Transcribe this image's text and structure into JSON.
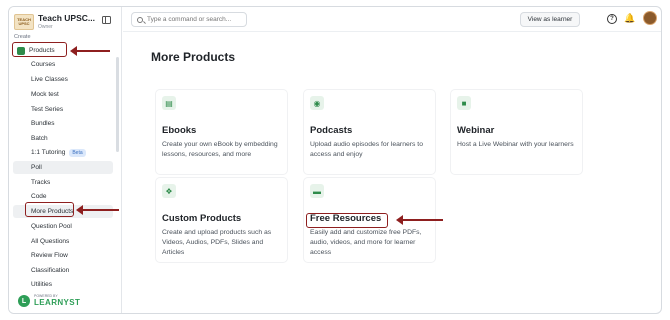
{
  "brand": {
    "logo_text": "TEACH UPSC",
    "name": "Teach UPSC...",
    "role": "Owner"
  },
  "sidebar": {
    "section_label": "Create",
    "parent_label": "Products",
    "items": [
      {
        "label": "Courses"
      },
      {
        "label": "Live Classes"
      },
      {
        "label": "Mock test"
      },
      {
        "label": "Test Series"
      },
      {
        "label": "Bundles"
      },
      {
        "label": "Batch"
      },
      {
        "label": "1:1 Tutoring",
        "badge": "Beta"
      },
      {
        "label": "Poll"
      },
      {
        "label": "Tracks"
      },
      {
        "label": "Code"
      },
      {
        "label": "More Products"
      },
      {
        "label": "Question Pool"
      },
      {
        "label": "All Questions"
      },
      {
        "label": "Review Flow"
      },
      {
        "label": "Classification"
      },
      {
        "label": "Utilities"
      }
    ],
    "footer": {
      "pre": "POWERED BY",
      "name": "LEARNYST",
      "logo": "L"
    }
  },
  "topbar": {
    "search_placeholder": "Type a command or search...",
    "view_learner": "View as learner",
    "help_glyph": "?",
    "bell_glyph": "🔔"
  },
  "main": {
    "title": "More Products",
    "cards": [
      {
        "icon": "ebook-icon",
        "glyph": "▤",
        "title": "Ebooks",
        "desc": "Create your own eBook by embedding lessons, resources, and more"
      },
      {
        "icon": "podcast-icon",
        "glyph": "◉",
        "title": "Podcasts",
        "desc": "Upload audio episodes for learners to access and enjoy"
      },
      {
        "icon": "video-icon",
        "glyph": "■",
        "title": "Webinar",
        "desc": "Host a Live Webinar with your learners"
      },
      {
        "icon": "custom-products-icon",
        "glyph": "❖",
        "title": "Custom Products",
        "desc": "Create and upload products such as Videos, Audios, PDFs, Slides and Articles"
      },
      {
        "icon": "folder-icon",
        "glyph": "▬",
        "title": "Free Resources",
        "desc": "Easily add and customize free PDFs, audio, videos, and more for learner access"
      }
    ]
  },
  "colors": {
    "accent_green": "#2e8b4a",
    "annotation_red": "#8e1f1f"
  }
}
